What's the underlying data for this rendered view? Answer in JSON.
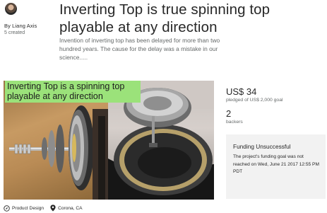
{
  "creator": {
    "by_line": "By Liang Axis",
    "created": "5 created"
  },
  "project": {
    "title": "Inverting Top is true spinning top playable at any direction",
    "blurb": "Invention of inverting top has been delayed for more than two hundred years. The cause for the delay was a mistake in our science.....",
    "video_caption": "Inverting Top is a spinning top playable at any direction"
  },
  "stats": {
    "pledged": "US$ 34",
    "goal": "pledged of US$ 2,000 goal",
    "backers_count": "2",
    "backers_label": "backers"
  },
  "funding": {
    "status": "Funding Unsuccessful",
    "message": "The project's funding goal was not reached on Wed, June 21 2017 12:55 PM PDT"
  },
  "tags": {
    "category": "Product Design",
    "location": "Corona, CA",
    "category_icon": "compass-icon",
    "location_icon": "map-pin-icon"
  },
  "colors": {
    "caption_bg": "#9be27a",
    "funding_box_bg": "#f2f2f2",
    "text_primary": "#282828",
    "text_secondary": "#656969"
  }
}
